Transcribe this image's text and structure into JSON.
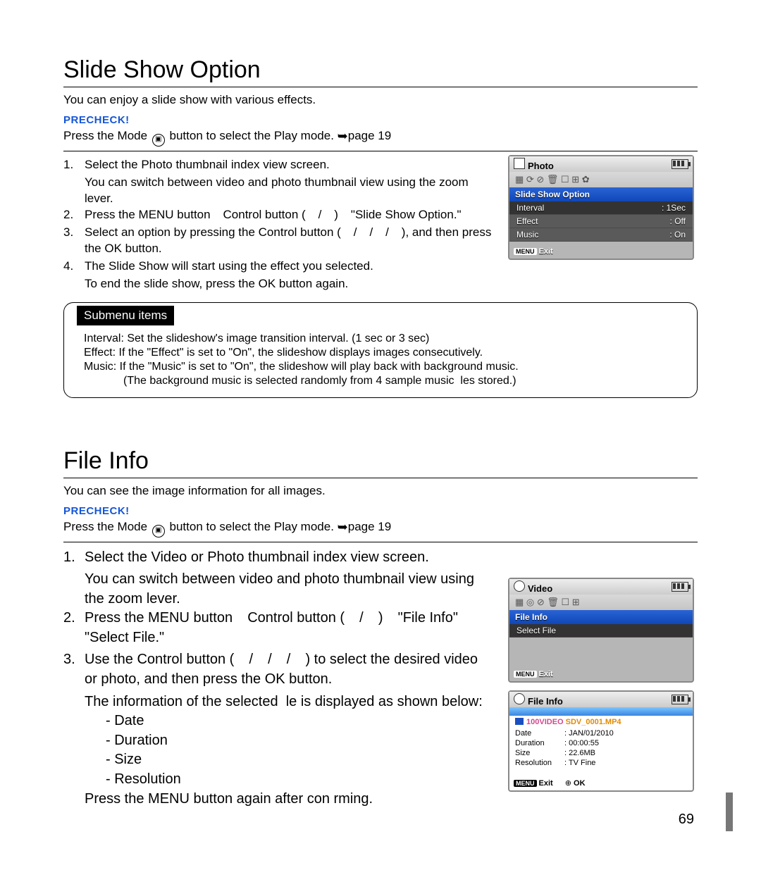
{
  "section1": {
    "title": "Slide Show Option",
    "intro": "You can enjoy a slide show with various effects.",
    "precheck": "PRECHECK!",
    "mode_pre": "Press the Mode ",
    "mode_post": " button to select the Play mode. ",
    "mode_ref": "page 19",
    "steps": [
      {
        "n": "1.",
        "t": "Select the Photo thumbnail index view screen.",
        "sub": "You can switch between video and photo thumbnail view using the zoom lever."
      },
      {
        "n": "2.",
        "t": "Press the MENU button   Control button (   /   )   \"Slide Show Option.\""
      },
      {
        "n": "3.",
        "t": "Select an option by pressing the Control button (   /   /   /   ), and then press the OK button."
      },
      {
        "n": "4.",
        "t": "The Slide Show will start using the effect you selected.",
        "sub2": "To end the slide show, press the OK button again."
      }
    ],
    "sub_heading": "Submenu items",
    "sub_items": [
      "Interval: Set the slideshow's image transition interval. (1 sec or 3 sec)",
      "Effect: If the \"Effect\" is set to \"On\", the slideshow displays images consecutively.",
      "Music: If the \"Music\" is set to \"On\", the slideshow will play back with background music."
    ],
    "sub_note": "(The background music is selected randomly from 4 sample music  les stored.)"
  },
  "section2": {
    "title": "File Info",
    "intro": "You can see the image information for all images.",
    "precheck": "PRECHECK!",
    "mode_pre": "Press the Mode ",
    "mode_post": " button to select the Play mode. ",
    "mode_ref": "page 19",
    "steps": [
      {
        "n": "1.",
        "t": "Select the Video or Photo thumbnail index view screen.",
        "sub": "You can switch between video and photo thumbnail view using the zoom lever."
      },
      {
        "n": "2.",
        "t": "Press the MENU button   Control button (   /   )   \"File Info\"   \"Select File.\""
      },
      {
        "n": "3.",
        "t": "Use the Control button (   /   /   /   ) to select the desired video or photo, and then press the OK button.",
        "sub3": "The information of the selected  le is displayed as shown below:",
        "bullets": [
          "Date",
          "Duration",
          "Size",
          "Resolution"
        ],
        "tail": "Press the MENU button again after con rming."
      }
    ]
  },
  "fig1": {
    "title": "Photo",
    "banner": "Slide Show Option",
    "rows": [
      [
        "Interval",
        ": 1Sec"
      ],
      [
        "Effect",
        ": Off"
      ],
      [
        "Music",
        ": On"
      ]
    ],
    "exit": "Exit"
  },
  "fig2": {
    "title": "Video",
    "banner": "File Info",
    "row": "Select File",
    "exit": "Exit"
  },
  "fig3": {
    "title": "File Info",
    "path1": "100VIDEO",
    "path2": "SDV_0001.MP4",
    "rows": [
      [
        "Date",
        ": JAN/01/2010"
      ],
      [
        "Duration",
        ": 00:00:55"
      ],
      [
        "Size",
        ": 22.6MB"
      ],
      [
        "Resolution",
        ": TV Fine"
      ]
    ],
    "exit": "Exit",
    "ok": "OK"
  },
  "page_number": "69"
}
